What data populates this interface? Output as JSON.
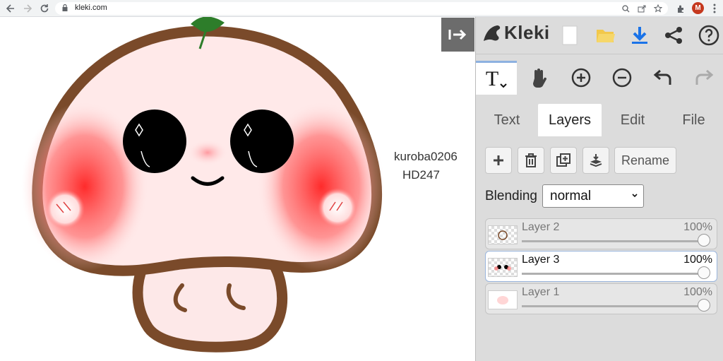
{
  "browser": {
    "url": "kleki.com",
    "avatar_letter": "M"
  },
  "canvas": {
    "username": "kuroba0206",
    "tag": "HD247"
  },
  "app": {
    "logo_text": "Kleki"
  },
  "tools": {
    "active_tool": "T"
  },
  "tabs": [
    {
      "label": "Text"
    },
    {
      "label": "Layers"
    },
    {
      "label": "Edit"
    },
    {
      "label": "File"
    }
  ],
  "layers_panel": {
    "rename_label": "Rename",
    "blending_label": "Blending",
    "blending_value": "normal",
    "layers": [
      {
        "name": "Layer 2",
        "opacity": "100%"
      },
      {
        "name": "Layer 3",
        "opacity": "100%"
      },
      {
        "name": "Layer 1",
        "opacity": "100%"
      }
    ]
  },
  "colors": {
    "accent": "#1a73e8",
    "sidebar_bg": "#dcdcdc"
  }
}
